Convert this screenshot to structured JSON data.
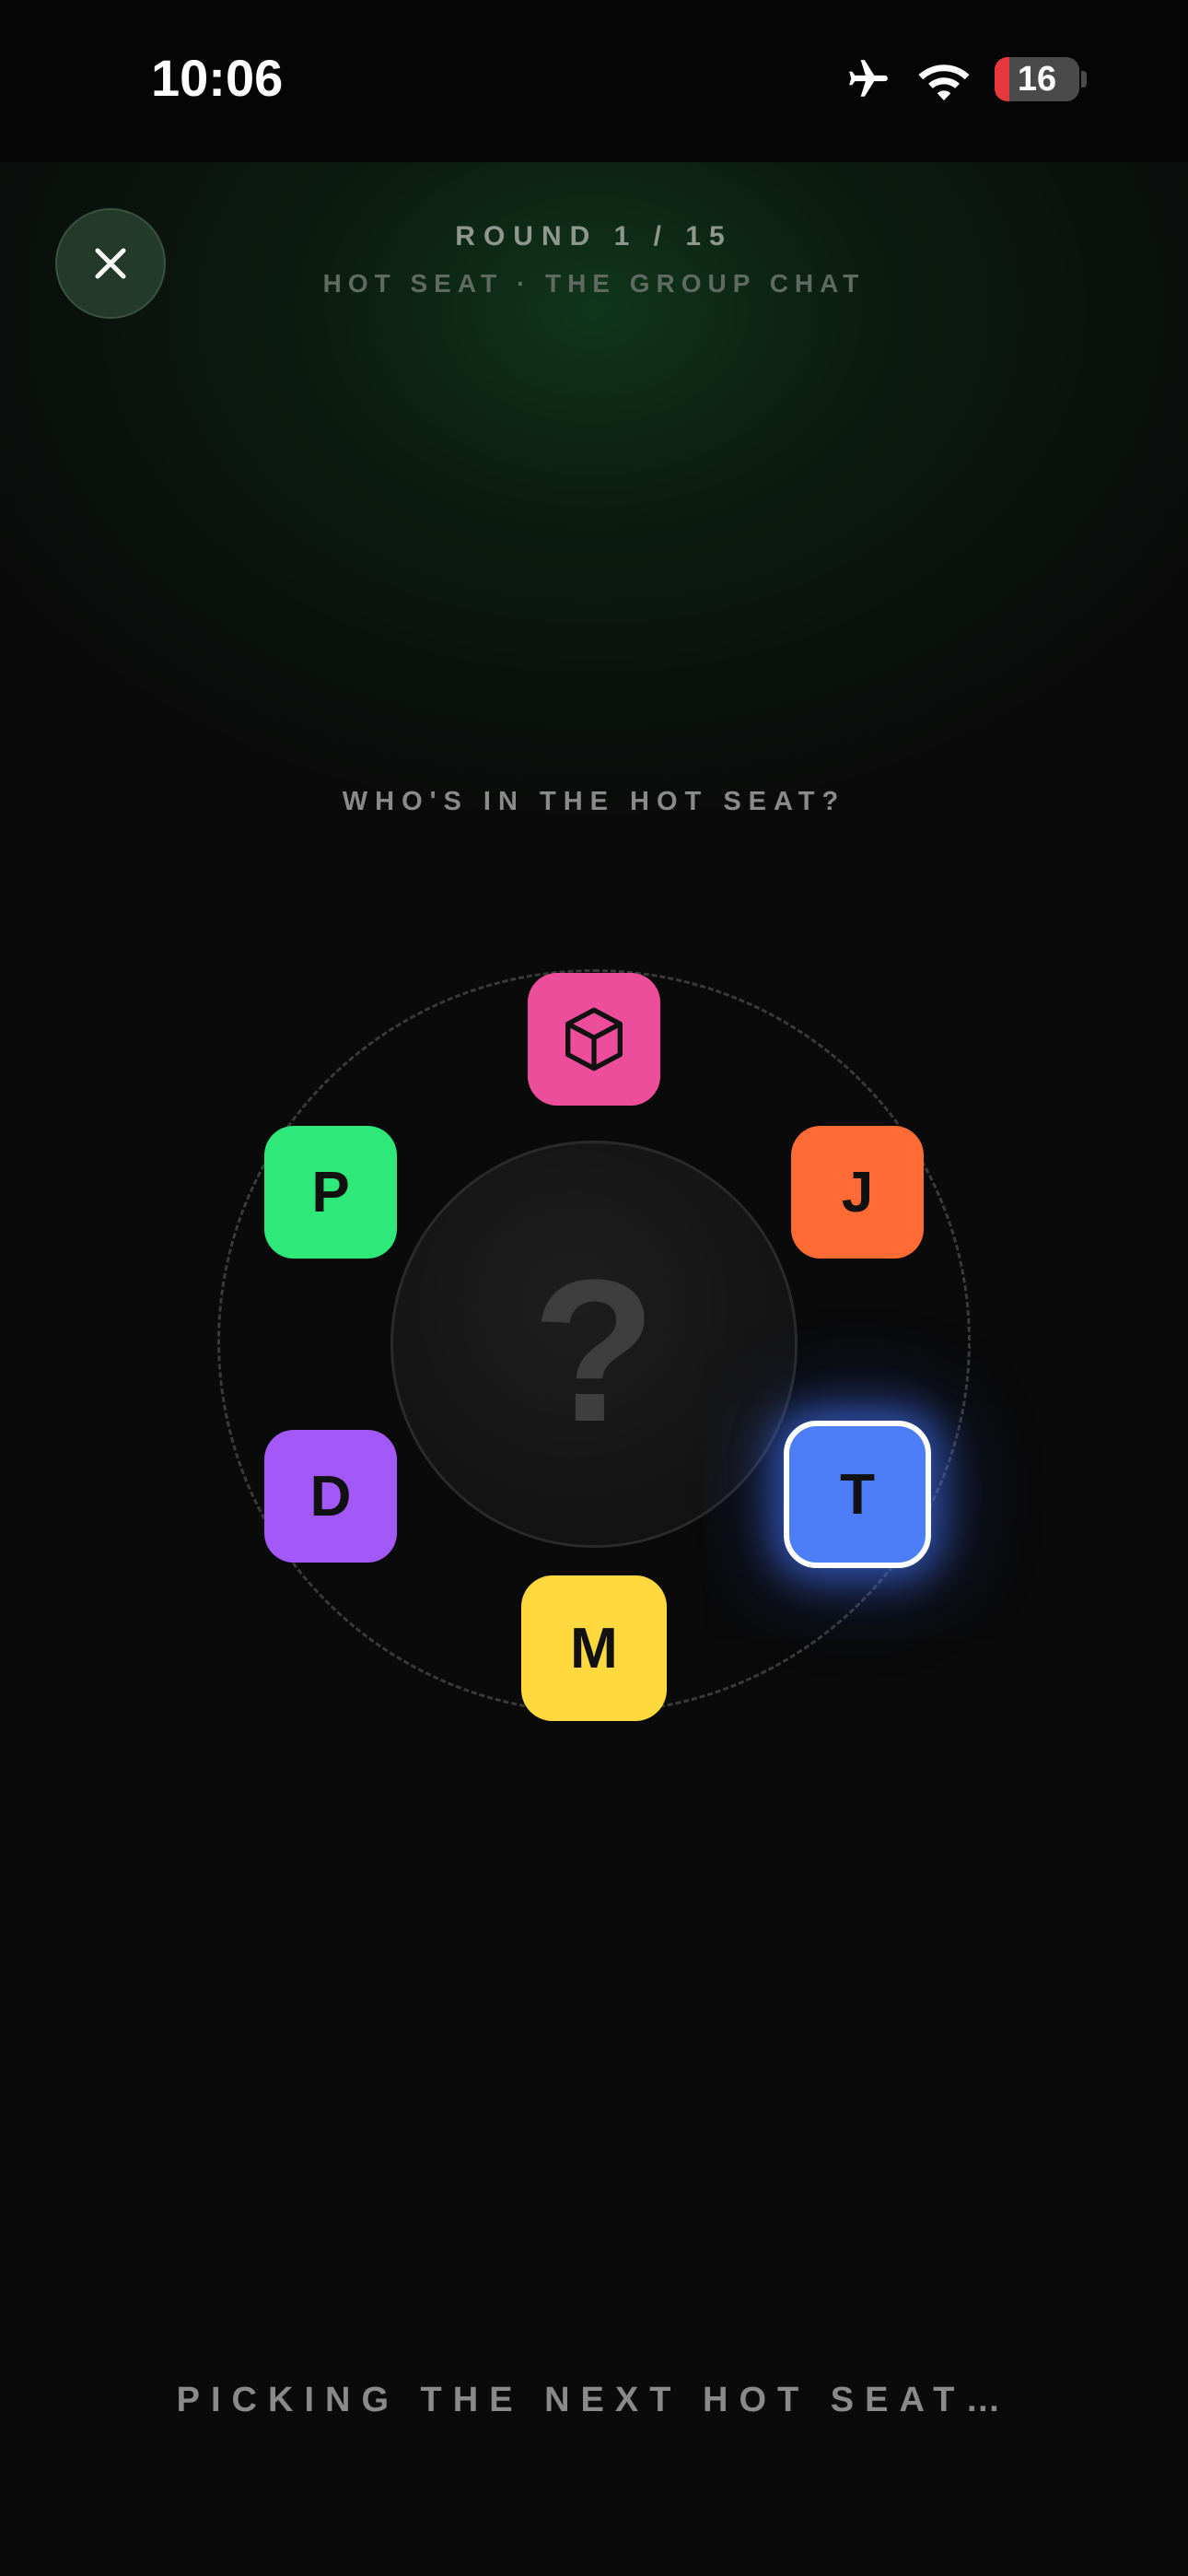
{
  "status_bar": {
    "time": "10:06",
    "battery_level": "16",
    "icons": [
      "airplane-icon",
      "wifi-icon",
      "battery-icon"
    ],
    "battery_low_color": "#e5373d"
  },
  "header": {
    "round": "ROUND 1 / 15",
    "mode": "HOT SEAT · THE GROUP CHAT",
    "close_icon": "close-icon"
  },
  "prompt": "WHO'S IN THE HOT SEAT?",
  "wheel": {
    "center_symbol": "?",
    "players": [
      {
        "id": "cube",
        "label": "",
        "icon": "cube-icon",
        "color": "#ec4e9c",
        "highlighted": false
      },
      {
        "id": "p",
        "label": "P",
        "color": "#2fe87a",
        "highlighted": false
      },
      {
        "id": "j",
        "label": "J",
        "color": "#ff6b35",
        "highlighted": false
      },
      {
        "id": "d",
        "label": "D",
        "color": "#a259f7",
        "highlighted": false
      },
      {
        "id": "t",
        "label": "T",
        "color": "#4d7ef7",
        "highlighted": true
      },
      {
        "id": "m",
        "label": "M",
        "color": "#ffd93d",
        "highlighted": false
      }
    ]
  },
  "footer": {
    "status": "PICKING THE NEXT HOT SEAT…"
  },
  "colors": {
    "background": "#0a0a0a",
    "glow": "#165a2a",
    "highlight_glow": "#4678ff"
  }
}
